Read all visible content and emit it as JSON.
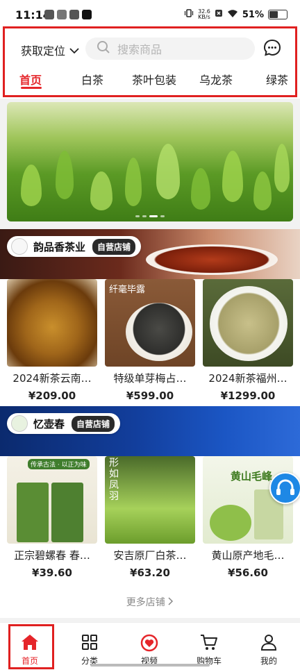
{
  "status": {
    "time": "11:14",
    "net_speed_value": "32.6",
    "net_speed_unit": "KB/s",
    "battery": "51%",
    "battery_level": 0.51
  },
  "header": {
    "location_label": "获取定位",
    "search_placeholder": "搜索商品",
    "tabs": [
      {
        "label": "首页",
        "active": true
      },
      {
        "label": "白茶",
        "active": false
      },
      {
        "label": "茶叶包装",
        "active": false
      },
      {
        "label": "乌龙茶",
        "active": false
      },
      {
        "label": "绿茶",
        "active": false
      }
    ]
  },
  "stores": [
    {
      "name": "韵品香茶业",
      "tag": "自营店铺",
      "products": [
        {
          "title": "2024新茶云南…",
          "price": "¥209.00",
          "image_text": ""
        },
        {
          "title": "特级单芽梅占…",
          "price": "¥599.00",
          "image_text": "纤毫毕露"
        },
        {
          "title": "2024新茶福州…",
          "price": "¥1299.00",
          "image_text": ""
        }
      ]
    },
    {
      "name": "忆壶春",
      "tag": "自营店铺",
      "products": [
        {
          "title": "正宗碧螺春 春…",
          "price": "¥39.60",
          "image_text": "传承古法 · 以正为味"
        },
        {
          "title": "安吉原厂白茶…",
          "price": "¥63.20",
          "image_text": "形如凤羽"
        },
        {
          "title": "黄山原产地毛…",
          "price": "¥56.60",
          "image_text": "黄山毛峰"
        }
      ]
    }
  ],
  "more_stores": "更多店铺",
  "bottom_nav": [
    {
      "label": "首页",
      "icon": "home-icon",
      "active": true
    },
    {
      "label": "分类",
      "icon": "grid-icon",
      "active": false
    },
    {
      "label": "视频",
      "icon": "heart-video-icon",
      "active": false
    },
    {
      "label": "购物车",
      "icon": "cart-icon",
      "active": false
    },
    {
      "label": "我的",
      "icon": "user-icon",
      "active": false
    }
  ],
  "colors": {
    "accent": "#e5252a",
    "highlight_box": "#e02020"
  }
}
